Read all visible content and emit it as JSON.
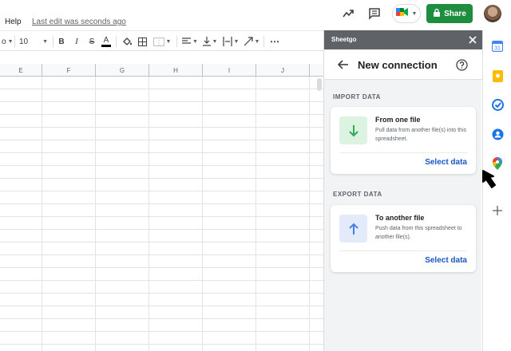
{
  "topbar": {
    "menu_help": "Help",
    "last_edit": "Last edit was seconds ago",
    "share_label": "Share",
    "icons": [
      "trending-icon",
      "comment-icon",
      "meet-icon",
      "lock-icon",
      "avatar"
    ]
  },
  "toolbar": {
    "font_fragment": "o",
    "font_size": "10",
    "bold": "B",
    "italic": "I",
    "strikethrough": "S",
    "text_color": "A",
    "more": "⋯"
  },
  "grid": {
    "columns": [
      "E",
      "F",
      "G",
      "H",
      "I",
      "J"
    ]
  },
  "panel": {
    "header_title": "Sheetgo",
    "nav_title": "New connection",
    "import_label": "IMPORT DATA",
    "export_label": "EXPORT DATA",
    "import_card": {
      "title": "From one file",
      "description": "Pull data from another file(s) into this spreadsheet.",
      "action": "Select data",
      "icon": "arrow-down-icon",
      "icon_bg": "#ddf3e2",
      "icon_color": "#34a853"
    },
    "export_card": {
      "title": "To another file",
      "description": "Push data from this spreadsheet to another file(s).",
      "action": "Select data",
      "icon": "arrow-up-icon",
      "icon_bg": "#e3ebfb",
      "icon_color": "#4a7fe0"
    }
  },
  "sidebar": {
    "icons": [
      "calendar-icon",
      "keep-icon",
      "tasks-icon",
      "contacts-icon",
      "maps-icon",
      "add-icon"
    ]
  },
  "colors": {
    "share_green": "#1e8e3e",
    "panel_header": "#5f6368",
    "action_blue": "#1a56c4"
  }
}
